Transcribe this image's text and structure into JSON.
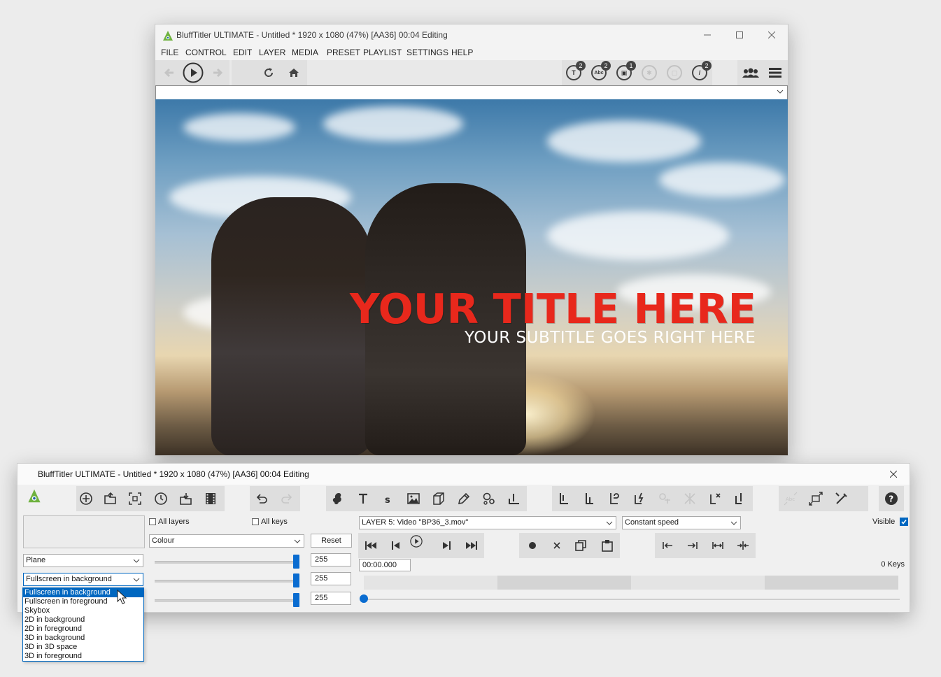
{
  "main_window": {
    "title": "BluffTitler ULTIMATE  - Untitled * 1920 x 1080 (47%) [AA36] 00:04 Editing",
    "menu": [
      "FILE",
      "CONTROL",
      "EDIT",
      "LAYER",
      "MEDIA",
      "PRESET",
      "PLAYLIST",
      "SETTINGS",
      "HELP"
    ],
    "toolbar_badges": [
      {
        "icon": "text-layer-icon",
        "glyph": "T",
        "count": "2"
      },
      {
        "icon": "abc-layer-icon",
        "glyph": "Abc",
        "count": "2"
      },
      {
        "icon": "picture-layer-icon",
        "glyph": "▣",
        "count": "1"
      },
      {
        "icon": "particle-layer-icon",
        "glyph": "",
        "count": ""
      },
      {
        "icon": "model-layer-icon",
        "glyph": "",
        "count": ""
      },
      {
        "icon": "effect-layer-icon",
        "glyph": "/",
        "count": "2"
      }
    ],
    "preset_combo_value": "",
    "preview": {
      "title_text": "YOUR TITLE HERE",
      "subtitle_text": "YOUR SUBTITLE GOES RIGHT HERE"
    }
  },
  "panel_window": {
    "title": "BluffTitler ULTIMATE  - Untitled * 1920 x 1080 (47%) [AA36] 00:04 Editing",
    "all_layers_label": "All layers",
    "all_keys_label": "All keys",
    "colour_combo": "Colour",
    "reset_label": "Reset",
    "shape_combo": "Plane",
    "mode_combo": "Fullscreen in background",
    "values": [
      "255",
      "255",
      "255"
    ],
    "layer_combo": "LAYER 5: Video \"BP36_3.mov\"",
    "speed_combo": "Constant speed",
    "visible_label": "Visible",
    "time_value": "00:00.000",
    "keys_label": "0 Keys",
    "dropdown_options": [
      "Fullscreen in background",
      "Fullscreen in foreground",
      "Skybox",
      "2D in background",
      "2D in foreground",
      "3D in background",
      "3D in 3D space",
      "3D in foreground"
    ]
  },
  "colors": {
    "accent": "#0067c0",
    "slider": "#0a6cd0",
    "title_red": "#e8281c"
  }
}
